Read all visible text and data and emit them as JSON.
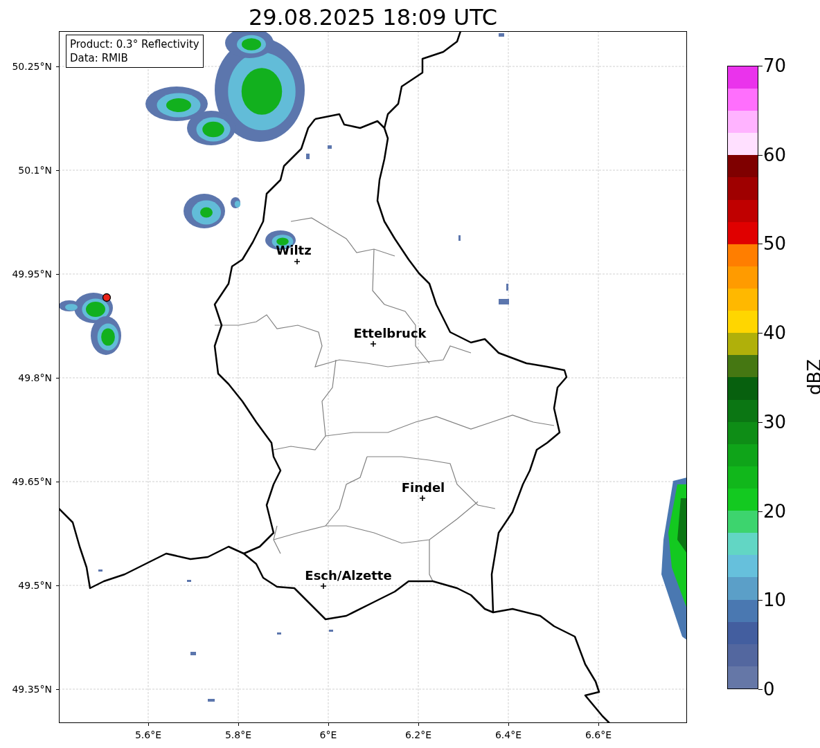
{
  "title": "29.08.2025 18:09 UTC",
  "info_box": {
    "lines": [
      "Product: 0.3° Reflectivity",
      "Data: RMIB"
    ]
  },
  "map": {
    "cities": [
      {
        "name": "Wiltz"
      },
      {
        "name": "Ettelbruck"
      },
      {
        "name": "Findel"
      },
      {
        "name": "Esch/Alzette"
      }
    ]
  },
  "y_axis": {
    "ticks": [
      "50.25°N",
      "50.1°N",
      "49.95°N",
      "49.8°N",
      "49.65°N",
      "49.5°N",
      "49.35°N"
    ]
  },
  "x_axis": {
    "ticks": [
      "5.6°E",
      "5.8°E",
      "6°E",
      "6.2°E",
      "6.4°E",
      "6.6°E"
    ]
  },
  "colorbar": {
    "label": "dBZ",
    "ticks": [
      "70",
      "60",
      "50",
      "40",
      "30",
      "20",
      "10",
      "0"
    ],
    "bins": [
      {
        "color": "#6577a7"
      },
      {
        "color": "#53679f"
      },
      {
        "color": "#435e9f"
      },
      {
        "color": "#4a78b1"
      },
      {
        "color": "#5b9fc8"
      },
      {
        "color": "#66c0dc"
      },
      {
        "color": "#62d6c4"
      },
      {
        "color": "#3dd46e"
      },
      {
        "color": "#13c920"
      },
      {
        "color": "#11b71b"
      },
      {
        "color": "#0fa419"
      },
      {
        "color": "#0e8d16"
      },
      {
        "color": "#0b7613"
      },
      {
        "color": "#07600e"
      },
      {
        "color": "#457712"
      },
      {
        "color": "#b0b00a"
      },
      {
        "color": "#ffd600"
      },
      {
        "color": "#ffb800"
      },
      {
        "color": "#ff9b00"
      },
      {
        "color": "#ff7e00"
      },
      {
        "color": "#e00000"
      },
      {
        "color": "#c00000"
      },
      {
        "color": "#9f0000"
      },
      {
        "color": "#7f0000"
      },
      {
        "color": "#ffe0ff"
      },
      {
        "color": "#ffb3ff"
      },
      {
        "color": "#ff6ffd"
      },
      {
        "color": "#ea33ec"
      }
    ]
  }
}
